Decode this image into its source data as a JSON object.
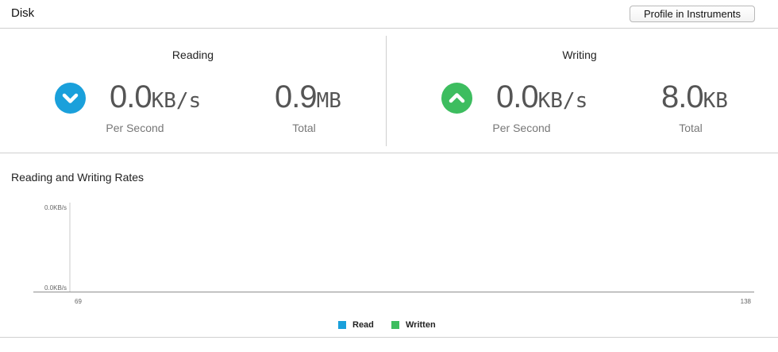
{
  "header": {
    "title": "Disk",
    "profile_button": "Profile in Instruments"
  },
  "reading": {
    "title": "Reading",
    "rate_value": "0.0",
    "rate_unit": "KB/s",
    "rate_label": "Per Second",
    "total_value": "0.9",
    "total_unit": "MB",
    "total_label": "Total",
    "icon": "chevron-down-icon",
    "color": "#1aa0db"
  },
  "writing": {
    "title": "Writing",
    "rate_value": "0.0",
    "rate_unit": "KB/s",
    "rate_label": "Per Second",
    "total_value": "8.0",
    "total_unit": "KB",
    "total_label": "Total",
    "icon": "chevron-up-icon",
    "color": "#3dbd5f"
  },
  "chart_title": "Reading and Writing Rates",
  "chart_data": {
    "type": "area",
    "title": "Reading and Writing Rates",
    "y_tick_labels": [
      "0.0KB/s",
      "0.0KB/s"
    ],
    "x_tick_labels": [
      "69",
      "138"
    ],
    "xlim": [
      69,
      138
    ],
    "ylim": [
      0,
      0
    ],
    "series": [
      {
        "name": "Read",
        "color": "#1aa0db",
        "values": []
      },
      {
        "name": "Written",
        "color": "#3dbd5f",
        "values": []
      }
    ],
    "legend": "bottom-center"
  }
}
